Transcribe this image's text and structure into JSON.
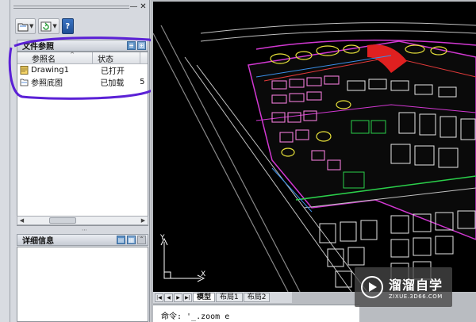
{
  "palette": {
    "title_controls": [
      "—",
      "✕"
    ],
    "toolbar": {
      "attach_icon": "attach-dwg-icon",
      "refresh_icon": "refresh-icon",
      "help_label": "?"
    },
    "file_references": {
      "title": "文件参照",
      "columns": [
        "参照名",
        "状态"
      ],
      "rows": [
        {
          "name": "Drawing1",
          "status": "已打开",
          "icon": "drawing-file-icon"
        },
        {
          "name": "参照底图",
          "status": "已加载",
          "extra": "5",
          "icon": "xref-file-icon"
        }
      ]
    },
    "details": {
      "title": "详细信息"
    }
  },
  "drawing": {
    "ucs_y": "Y",
    "ucs_x": "X",
    "tabs": [
      "模型",
      "布局1",
      "布局2"
    ],
    "command_line": "命令: '_.zoom  e"
  },
  "watermark": {
    "title": "溜溜自学",
    "subtitle": "ZIXUE.3D66.COM"
  },
  "colors": {
    "annotation": "#5b21d6",
    "canvas": "#000000",
    "palette_bg": "#d6d9df"
  }
}
